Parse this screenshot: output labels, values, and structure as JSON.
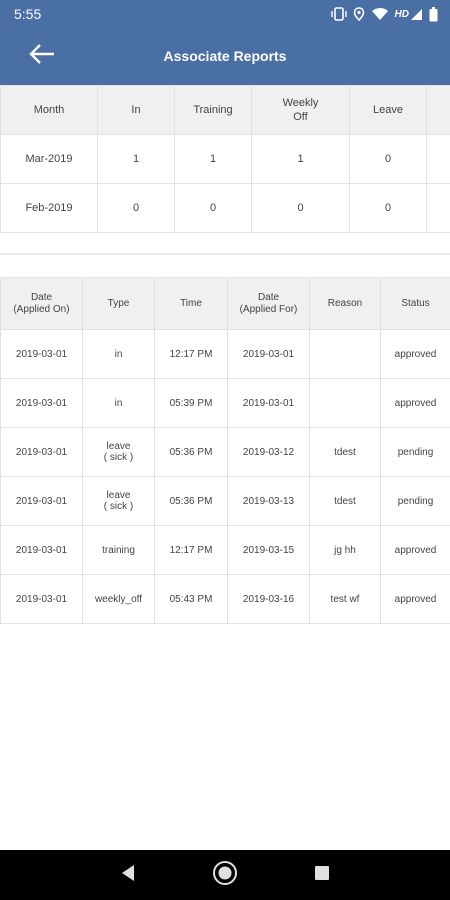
{
  "status_bar": {
    "time": "5:55",
    "icons": [
      "vibrate-icon",
      "location-icon",
      "wifi-icon",
      "hd-signal-icon",
      "battery-icon"
    ],
    "hd_label": "HD"
  },
  "header": {
    "title": "Associate Reports",
    "back_icon": "arrow-left-icon",
    "background": "#4a6fa5"
  },
  "summary_table": {
    "columns": [
      "Month",
      "In",
      "Training",
      "Weekly\nOff",
      "Leave"
    ],
    "rows": [
      [
        "Mar-2019",
        "1",
        "1",
        "1",
        "0"
      ],
      [
        "Feb-2019",
        "0",
        "0",
        "0",
        "0"
      ]
    ]
  },
  "detail_table": {
    "columns": [
      "Date\n(Applied On)",
      "Type",
      "Time",
      "Date\n(Applied For)",
      "Reason",
      "Status"
    ],
    "rows": [
      [
        "2019-03-01",
        "in",
        "12:17 PM",
        "2019-03-01",
        "",
        "approved"
      ],
      [
        "2019-03-01",
        "in",
        "05:39 PM",
        "2019-03-01",
        "",
        "approved"
      ],
      [
        "2019-03-01",
        "leave\n( sick )",
        "05:36 PM",
        "2019-03-12",
        "tdest",
        "pending"
      ],
      [
        "2019-03-01",
        "leave\n( sick )",
        "05:36 PM",
        "2019-03-13",
        "tdest",
        "pending"
      ],
      [
        "2019-03-01",
        "training",
        "12:17 PM",
        "2019-03-15",
        "jg hh",
        "approved"
      ],
      [
        "2019-03-01",
        "weekly_off",
        "05:43 PM",
        "2019-03-16",
        "test wf",
        "approved"
      ]
    ]
  },
  "nav_bar": {
    "buttons": [
      "back-triangle-icon",
      "home-circle-icon",
      "recents-square-icon"
    ]
  }
}
